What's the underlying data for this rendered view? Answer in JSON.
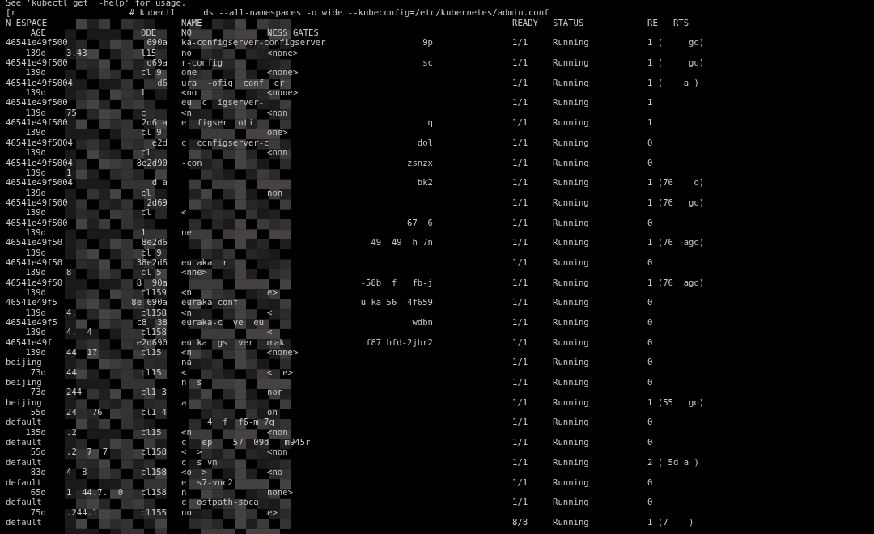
{
  "preamble": [
    "See 'kubectl get  -help' for usage."
  ],
  "prompt": {
    "user": "[r",
    "command": "# kubectl",
    "args": "ds --all-namespaces -o wide --kubeconfig=/etc/kubernetes/admin.conf"
  },
  "header": {
    "namespace": "N ESPACE",
    "name": "NAME",
    "ready": "READY",
    "status": "STATUS",
    "restarts": "RE   RTS",
    "age": "AGE",
    "node": "ODE",
    "nominated": "NO",
    "gates": "NESS GATES"
  },
  "rows": [
    {
      "namespace": "46541e49f500",
      "namespace_tail": "690a",
      "name": "ka-configserver-configserver",
      "name_tail": "9p",
      "ready": "1/1",
      "status": "Running",
      "restarts": "1 (     go)",
      "age": "139d",
      "ip": "3.43",
      "node": "l15",
      "nominated": "no",
      "gates": "<none>"
    },
    {
      "namespace": "46541e49f500",
      "namespace_tail": "d69a",
      "name": "r-config",
      "name_tail": "sc",
      "ready": "1/1",
      "status": "Running",
      "restarts": "1 (     go)",
      "age": "139d",
      "ip": "",
      "node": "cl 9",
      "nominated": "one",
      "gates": "<none>"
    },
    {
      "namespace": "46541e49f5004",
      "namespace_tail": "d6",
      "name": "ura  -ofig  conf  er",
      "name_tail": "",
      "ready": "1/1",
      "status": "Running",
      "restarts": "1 (    a )",
      "age": "139d",
      "ip": "",
      "node": "l",
      "nominated": "<no",
      "gates": "<none>"
    },
    {
      "namespace": "46541e49f500",
      "namespace_tail": "",
      "name": "eu  c  igserver-",
      "name_tail": "",
      "ready": "1/1",
      "status": "Running",
      "restarts": "1",
      "age": "139d",
      "ip": "75",
      "node": "c",
      "nominated": "<n",
      "gates": "<non"
    },
    {
      "namespace": "46541e49f500",
      "namespace_tail": "2d6 a",
      "name": "e  figser  nti",
      "name_tail": "q",
      "ready": "1/1",
      "status": "Running",
      "restarts": "1",
      "age": "139d",
      "ip": "",
      "node": "cl 9",
      "nominated": "",
      "gates": "one>"
    },
    {
      "namespace": "46541e49f5004",
      "namespace_tail": "e2d",
      "name": "c  configserver-c",
      "name_tail": "dol",
      "ready": "1/1",
      "status": "Running",
      "restarts": "0",
      "age": "139d",
      "ip": "",
      "node": "cl",
      "nominated": "",
      "gates": "<non"
    },
    {
      "namespace": "46541e49f5004",
      "namespace_tail": "8e2d90",
      "name": "-con",
      "name_tail": "zsnzx",
      "ready": "1/1",
      "status": "Running",
      "restarts": "0",
      "age": "139d",
      "ip": "1",
      "node": "",
      "nominated": "",
      "gates": ""
    },
    {
      "namespace": "46541e49f5004",
      "namespace_tail": "d a",
      "name": "",
      "name_tail": "bk2",
      "ready": "1/1",
      "status": "Running",
      "restarts": "1 (76    o)",
      "age": "139d",
      "ip": "",
      "node": "cl",
      "nominated": "",
      "gates": "non"
    },
    {
      "namespace": "46541e49f500",
      "namespace_tail": "2d69",
      "name": "",
      "name_tail": "",
      "ready": "1/1",
      "status": "Running",
      "restarts": "1 (76   go)",
      "age": "139d",
      "ip": "",
      "node": "cl",
      "nominated": "<",
      "gates": ""
    },
    {
      "namespace": "46541e49f500",
      "namespace_tail": "",
      "name": "",
      "name_tail": "67  6",
      "ready": "1/1",
      "status": "Running",
      "restarts": "0",
      "age": "139d",
      "ip": "",
      "node": "1",
      "nominated": "ne",
      "gates": ""
    },
    {
      "namespace": "46541e49f50",
      "namespace_tail": "8e2d6",
      "name": "",
      "name_tail": "49  49  h 7n",
      "ready": "1/1",
      "status": "Running",
      "restarts": "1 (76  ago)",
      "age": "139d",
      "ip": "",
      "node": "cl 9",
      "nominated": "",
      "gates": ""
    },
    {
      "namespace": "46541e49f50",
      "namespace_tail": "38e2d6",
      "name": "eu aka  r",
      "name_tail": "",
      "ready": "1/1",
      "status": "Running",
      "restarts": "0",
      "age": "139d",
      "ip": "8",
      "node": "cl 5",
      "nominated": "<nne>",
      "gates": ""
    },
    {
      "namespace": "46541e49f50",
      "namespace_tail": "8  90a",
      "name": "",
      "name_tail": "-58b  f   fb-j",
      "ready": "1/1",
      "status": "Running",
      "restarts": "1 (76  ago)",
      "age": "139d",
      "ip": "",
      "node": "cl159",
      "nominated": "<n",
      "gates": "e>"
    },
    {
      "namespace": "46541e49f5",
      "namespace_tail": "8e 690a",
      "name": "euraka-conf",
      "name_tail": "u ka-56  4f659",
      "ready": "1/1",
      "status": "Running",
      "restarts": "0",
      "age": "139d",
      "ip": "4.",
      "node": "cl158",
      "nominated": "<n",
      "gates": "<"
    },
    {
      "namespace": "46541e49f5",
      "namespace_tail": "c8  38",
      "name": "euraka-c  ve  eu",
      "name_tail": "wdbn",
      "ready": "1/1",
      "status": "Running",
      "restarts": "0",
      "age": "139d",
      "ip": "4.  4",
      "node": "cl158",
      "nominated": "",
      "gates": "<"
    },
    {
      "namespace": "46541e49f",
      "namespace_tail": "e2d690",
      "name": "eu ka  gs  ver  urak",
      "name_tail": "f87 bfd-2jbr2",
      "ready": "1/1",
      "status": "Running",
      "restarts": "0",
      "age": "139d",
      "ip": "44  17",
      "node": "cl15",
      "nominated": "<n",
      "gates": "<none>"
    },
    {
      "namespace": "beijing",
      "namespace_tail": "",
      "name": "na",
      "name_tail": "",
      "ready": "1/1",
      "status": "Running",
      "restarts": "0",
      "age": "73d",
      "ip": "44",
      "node": "cl15",
      "nominated": "<",
      "gates": "<  e>"
    },
    {
      "namespace": "beijing",
      "namespace_tail": "",
      "name": "n  s",
      "name_tail": "",
      "ready": "1/1",
      "status": "Running",
      "restarts": "0",
      "age": "73d",
      "ip": "244",
      "node": "cl1 3",
      "nominated": "",
      "gates": "nor"
    },
    {
      "namespace": "beijing",
      "namespace_tail": "",
      "name": "a",
      "name_tail": "",
      "ready": "1/1",
      "status": "Running",
      "restarts": "1 (55   go)",
      "age": "55d",
      "ip": "24   76",
      "node": "cl1 4",
      "nominated": "",
      "gates": "on"
    },
    {
      "namespace": "default",
      "namespace_tail": "",
      "name": "     4  f  f6-m 7g",
      "name_tail": "",
      "ready": "1/1",
      "status": "Running",
      "restarts": "0",
      "age": "135d",
      "ip": ".2",
      "node": "cl15",
      "nominated": "<n",
      "gates": "<non"
    },
    {
      "namespace": "default",
      "namespace_tail": "",
      "name": "c   ep   -57  09d  -m945r",
      "name_tail": "",
      "ready": "1/1",
      "status": "Running",
      "restarts": "0",
      "age": "55d",
      "ip": ".2  7  7",
      "node": "cl158",
      "nominated": "<  >",
      "gates": "<non"
    },
    {
      "namespace": "default",
      "namespace_tail": "",
      "name": "c  s vn",
      "name_tail": "",
      "ready": "1/1",
      "status": "Running",
      "restarts": "2 ( 5d a )",
      "age": "83d",
      "ip": "4  8",
      "node": "cl158",
      "nominated": "<o  >",
      "gates": "<no"
    },
    {
      "namespace": "default",
      "namespace_tail": "",
      "name": "e  s7-vnc2",
      "name_tail": "",
      "ready": "1/1",
      "status": "Running",
      "restarts": "0",
      "age": "65d",
      "ip": "1  44.7.  0",
      "node": "cl158",
      "nominated": "n",
      "gates": "none>"
    },
    {
      "namespace": "default",
      "namespace_tail": "",
      "name": "c  ostpath-soca",
      "name_tail": "",
      "ready": "1/1",
      "status": "Running",
      "restarts": "0",
      "age": "75d",
      "ip": ".244.1.",
      "node": "cl155",
      "nominated": "no",
      "gates": "e>"
    },
    {
      "namespace": "default",
      "namespace_tail": "",
      "name": "",
      "name_tail": "",
      "ready": "8/8",
      "status": "Running",
      "restarts": "1 (7    )"
    }
  ]
}
